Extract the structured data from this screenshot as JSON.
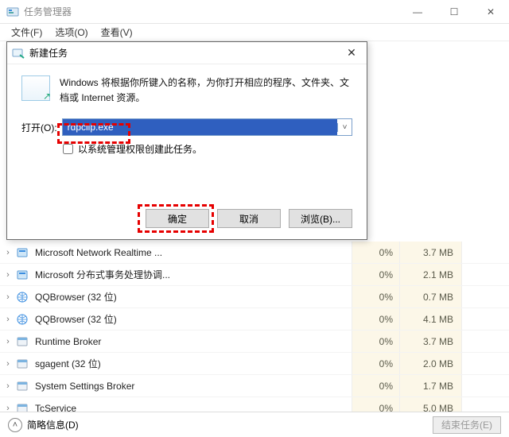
{
  "window": {
    "title": "任务管理器",
    "minimize": "—",
    "maximize": "☐",
    "close": "✕"
  },
  "menu": {
    "file": "文件(F)",
    "options": "选项(O)",
    "view": "查看(V)"
  },
  "dialog": {
    "title": "新建任务",
    "close": "✕",
    "message": "Windows 将根据你所键入的名称，为你打开相应的程序、文件夹、文档或 Internet 资源。",
    "open_label": "打开(O):",
    "input_value": "rdpclip.exe",
    "checkbox_label": "以系统管理权限创建此任务。",
    "ok": "确定",
    "cancel": "取消",
    "browse": "浏览(B)..."
  },
  "processes": [
    {
      "name": "Microsoft Network Realtime ...",
      "cpu": "0%",
      "mem": "3.7 MB",
      "icon": "app-blue"
    },
    {
      "name": "Microsoft 分布式事务处理协调...",
      "cpu": "0%",
      "mem": "2.1 MB",
      "icon": "app-blue"
    },
    {
      "name": "QQBrowser (32 位)",
      "cpu": "0%",
      "mem": "0.7 MB",
      "icon": "globe"
    },
    {
      "name": "QQBrowser (32 位)",
      "cpu": "0%",
      "mem": "4.1 MB",
      "icon": "globe"
    },
    {
      "name": "Runtime Broker",
      "cpu": "0%",
      "mem": "3.7 MB",
      "icon": "window"
    },
    {
      "name": "sgagent (32 位)",
      "cpu": "0%",
      "mem": "2.0 MB",
      "icon": "window"
    },
    {
      "name": "System Settings Broker",
      "cpu": "0%",
      "mem": "1.7 MB",
      "icon": "window"
    },
    {
      "name": "TcService",
      "cpu": "0%",
      "mem": "5.0 MB",
      "icon": "window"
    }
  ],
  "statusbar": {
    "toggle_label": "简略信息(D)",
    "end_task": "结束任务(E)"
  }
}
